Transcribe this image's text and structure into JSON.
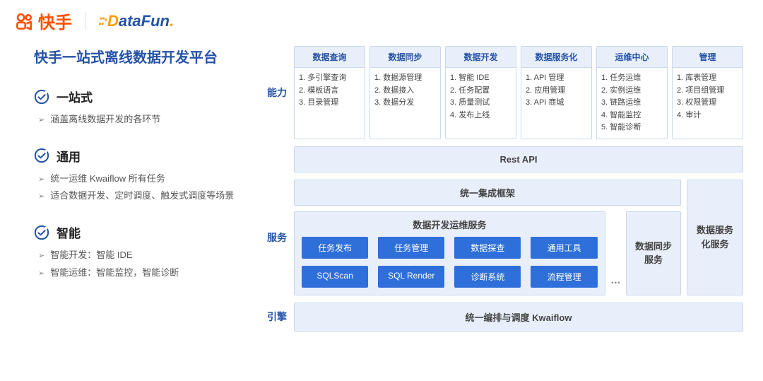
{
  "header": {
    "kuaishou": "快手",
    "datafun_d": "D",
    "datafun_rest": "ataFun",
    "datafun_dot": "."
  },
  "subtitle": "快手一站式离线数据开发平台",
  "features": [
    {
      "title": "一站式",
      "items": [
        "涵盖离线数据开发的各环节"
      ]
    },
    {
      "title": "通用",
      "items": [
        "统一运维 Kwaiflow 所有任务",
        "适合数据开发、定时调度、触发式调度等场景"
      ]
    },
    {
      "title": "智能",
      "items": [
        "智能开发：智能 IDE",
        "智能运维：智能监控，智能诊断"
      ]
    }
  ],
  "labels": {
    "capability": "能力",
    "service": "服务",
    "engine": "引擎"
  },
  "capabilities": [
    {
      "title": "数据查询",
      "items": [
        "1. 多引擎查询",
        "2. 模板语言",
        "3. 目录管理"
      ]
    },
    {
      "title": "数据同步",
      "items": [
        "1. 数据源管理",
        "2. 数据接入",
        "3. 数据分发"
      ]
    },
    {
      "title": "数据开发",
      "items": [
        "1. 智能 IDE",
        "2. 任务配置",
        "3. 质量测试",
        "4. 发布上线"
      ]
    },
    {
      "title": "数据服务化",
      "items": [
        "1. API 管理",
        "2. 应用管理",
        "3. API 商城"
      ]
    },
    {
      "title": "运维中心",
      "items": [
        "1. 任务运维",
        "2. 实例运维",
        "3. 链路运维",
        "4. 智能监控",
        "5. 智能诊断"
      ]
    },
    {
      "title": "管理",
      "items": [
        "1. 库表管理",
        "2. 项目组管理",
        "3. 权限管理",
        "4. 审计"
      ]
    }
  ],
  "rest_api": "Rest API",
  "integration": "统一集成框架",
  "devops": {
    "title": "数据开发运维服务",
    "pills": [
      "任务发布",
      "任务管理",
      "数据探查",
      "通用工具",
      "SQLScan",
      "SQL Render",
      "诊断系统",
      "流程管理"
    ]
  },
  "dots": "...",
  "sync_service": "数据同步服务",
  "dataservice_service": "数据服务化服务",
  "engine": "统一编排与调度 Kwaiflow"
}
